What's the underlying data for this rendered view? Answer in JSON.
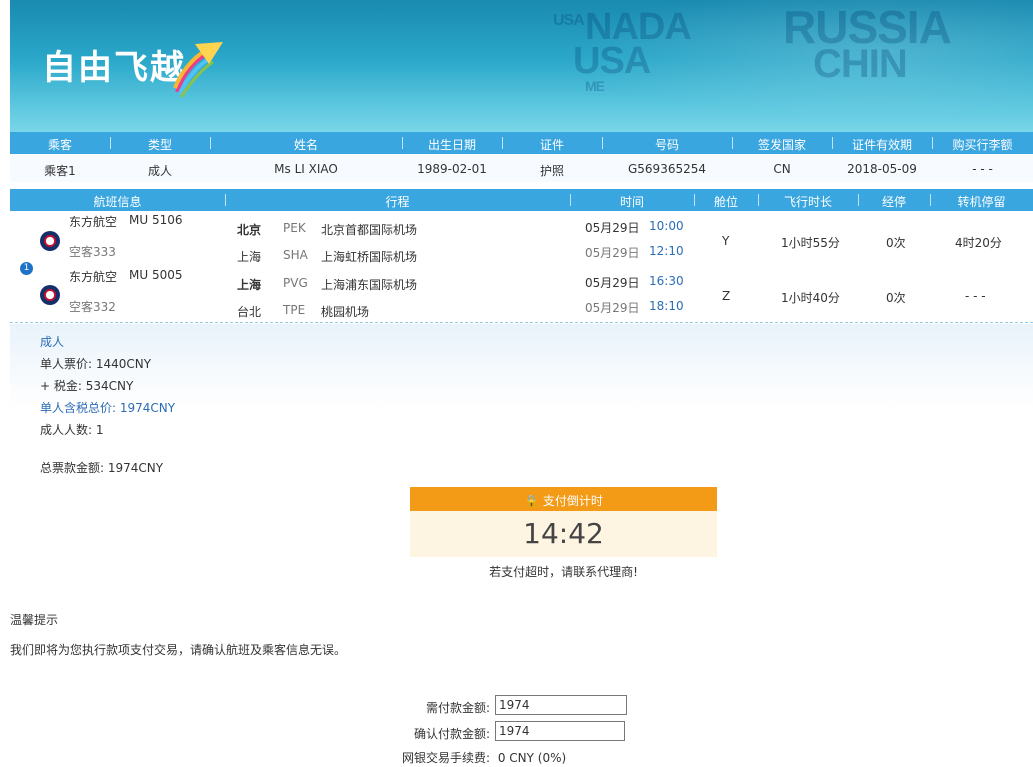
{
  "header": {
    "logo_text": "自由飞越",
    "map_words": [
      "USA",
      "NADA",
      "USA",
      "RUSSIA",
      "CHIN",
      "ME"
    ]
  },
  "passenger_table": {
    "columns": [
      "乘客",
      "类型",
      "姓名",
      "出生日期",
      "证件",
      "号码",
      "签发国家",
      "证件有效期",
      "购买行李额"
    ],
    "rows": [
      [
        "乘客1",
        "成人",
        "Ms LI XIAO",
        "1989-02-01",
        "护照",
        "G569365254",
        "CN",
        "2018-05-09",
        "- - -"
      ]
    ]
  },
  "flight_table": {
    "columns": [
      "航班信息",
      "行程",
      "时间",
      "舱位",
      "飞行时长",
      "经停",
      "转机停留"
    ],
    "badge": "1",
    "segments": [
      {
        "airline": "东方航空",
        "flight_no": "MU  5106",
        "aircraft": "空客333",
        "dep_city": "北京",
        "dep_code": "PEK",
        "dep_airport": "北京首都国际机场",
        "arr_city": "上海",
        "arr_code": "SHA",
        "arr_airport": "上海虹桥国际机场",
        "dep_date": "05月29日",
        "dep_time": "10:00",
        "arr_date": "05月29日",
        "arr_time": "12:10",
        "cabin": "Y",
        "duration": "1小时55分",
        "stops": "0次",
        "layover": "4时20分"
      },
      {
        "airline": "东方航空",
        "flight_no": "MU  5005",
        "aircraft": "空客332",
        "dep_city": "上海",
        "dep_code": "PVG",
        "dep_airport": "上海浦东国际机场",
        "arr_city": "台北",
        "arr_code": "TPE",
        "arr_airport": "桃园机场",
        "dep_date": "05月29日",
        "dep_time": "16:30",
        "arr_date": "05月29日",
        "arr_time": "18:10",
        "cabin": "Z",
        "duration": "1小时40分",
        "stops": "0次",
        "layover": "- - -"
      }
    ]
  },
  "price": {
    "type_label": "成人",
    "unit_price": "单人票价: 1440CNY",
    "tax": "+ 税金: 534CNY",
    "unit_total": "单人含税总价: 1974CNY",
    "count": "成人人数:   1",
    "grand_total": "总票款金额: 1974CNY"
  },
  "timer": {
    "title": "支付倒计时",
    "value": "14:42",
    "note": "若支付超时，请联系代理商!"
  },
  "tips": {
    "title": "温馨提示",
    "text": "我们即将为您执行款项支付交易，请确认航班及乘客信息无误。"
  },
  "payment": {
    "required_label": "需付款金额:",
    "required_value": "1974",
    "confirm_label": "确认付款金额:",
    "confirm_value": "1974",
    "fee_label": "网银交易手续费:",
    "fee_value": "0 CNY (0%)"
  },
  "colors": {
    "header_bar": "#3aa6e0",
    "timer_orange": "#f39b17",
    "link_blue": "#2b6cb6"
  }
}
